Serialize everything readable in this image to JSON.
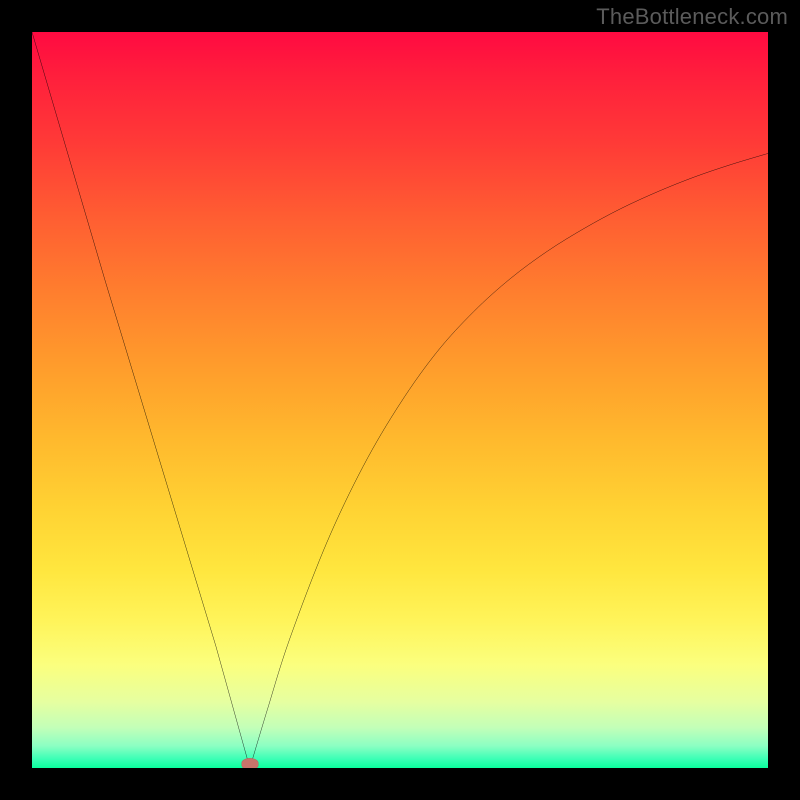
{
  "watermark": "TheBottleneck.com",
  "chart_data": {
    "type": "line",
    "title": "",
    "xlabel": "",
    "ylabel": "",
    "xlim": [
      0,
      100
    ],
    "ylim": [
      0,
      100
    ],
    "grid": false,
    "background_gradient": {
      "top": "#ff0a41",
      "bottom": "#0aff9d",
      "meaning": "higher y = worse (bottleneck), lower y = better (balanced)"
    },
    "marker": {
      "x": 29.6,
      "y": 0.5,
      "color": "#c9746b"
    },
    "series": [
      {
        "name": "bottleneck-curve",
        "segment": "left",
        "x": [
          0,
          5,
          10,
          15,
          20,
          25,
          29.6
        ],
        "y": [
          100,
          83,
          66,
          49.5,
          33,
          16.5,
          0
        ]
      },
      {
        "name": "bottleneck-curve",
        "segment": "right",
        "x": [
          29.6,
          32,
          35,
          40,
          45,
          50,
          55,
          60,
          65,
          70,
          75,
          80,
          85,
          90,
          95,
          100
        ],
        "y": [
          0,
          8,
          17.5,
          30.5,
          41,
          49.5,
          56.5,
          62,
          66.5,
          70.2,
          73.3,
          76,
          78.3,
          80.3,
          82,
          83.5
        ]
      }
    ],
    "annotations": []
  }
}
